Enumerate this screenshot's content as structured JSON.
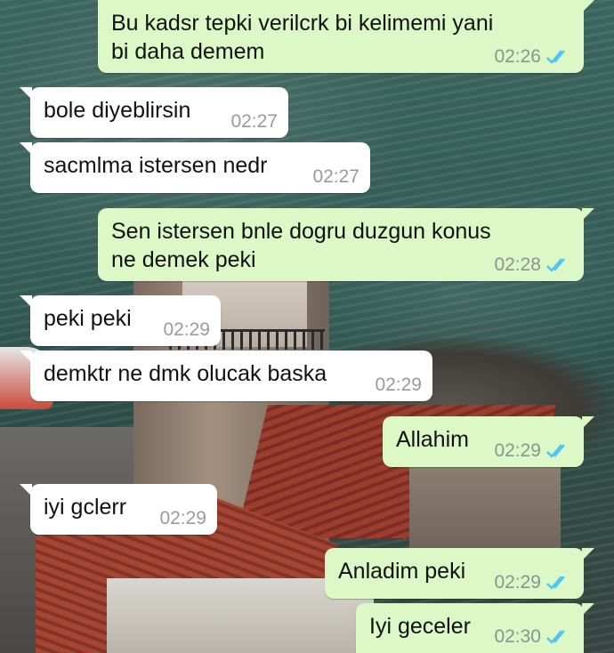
{
  "colors": {
    "incoming_bubble": "#ffffff",
    "outgoing_bubble": "#dcf8c6",
    "read_ticks": "#4fc3f7"
  },
  "messages": [
    {
      "direction": "outgoing",
      "text": "Bu kadsr tepki verilcrk bi kelimemi yani bi daha demem",
      "time": "02:26",
      "status": "read-double-tick-icon"
    },
    {
      "direction": "incoming",
      "text": "bole diyeblirsin",
      "time": "02:27"
    },
    {
      "direction": "incoming",
      "text": "sacmlma istersen nedr",
      "time": "02:27"
    },
    {
      "direction": "outgoing",
      "text": "Sen istersen bnle dogru duzgun konus ne demek peki",
      "time": "02:28",
      "status": "read-double-tick-icon"
    },
    {
      "direction": "incoming",
      "text": "peki peki",
      "time": "02:29"
    },
    {
      "direction": "incoming",
      "text": "demktr ne dmk olucak baska",
      "time": "02:29"
    },
    {
      "direction": "outgoing",
      "text": "Allahim",
      "time": "02:29",
      "status": "read-double-tick-icon"
    },
    {
      "direction": "incoming",
      "text": "iyi gclerr",
      "time": "02:29"
    },
    {
      "direction": "outgoing",
      "text": "Anladim peki",
      "time": "02:29",
      "status": "read-double-tick-icon"
    },
    {
      "direction": "outgoing",
      "text": "Iyi geceler",
      "time": "02:30",
      "status": "read-double-tick-icon"
    }
  ]
}
